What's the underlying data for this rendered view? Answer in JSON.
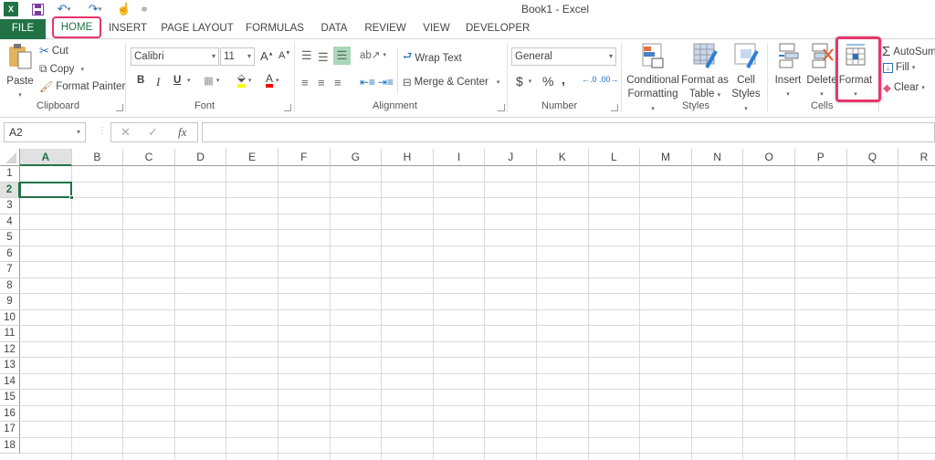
{
  "window": {
    "title": "Book1 - Excel"
  },
  "quick_access": [
    {
      "name": "excel-logo-icon"
    },
    {
      "name": "save-icon"
    },
    {
      "name": "undo-icon"
    },
    {
      "name": "redo-icon"
    },
    {
      "name": "touch-mode-icon"
    },
    {
      "name": "customize-qat-icon"
    }
  ],
  "tabs": [
    {
      "label": "FILE"
    },
    {
      "label": "HOME"
    },
    {
      "label": "INSERT"
    },
    {
      "label": "PAGE LAYOUT"
    },
    {
      "label": "FORMULAS"
    },
    {
      "label": "DATA"
    },
    {
      "label": "REVIEW"
    },
    {
      "label": "VIEW"
    },
    {
      "label": "DEVELOPER"
    }
  ],
  "ribbon": {
    "clipboard": {
      "label": "Clipboard",
      "paste": "Paste",
      "cut": "Cut",
      "copy": "Copy",
      "format_painter": "Format Painter"
    },
    "font": {
      "label": "Font",
      "font_name": "Calibri",
      "font_size": "11",
      "bold": "B",
      "italic": "I",
      "underline": "U",
      "highlight_color": "#ffff00",
      "font_color": "#ff0000"
    },
    "alignment": {
      "label": "Alignment",
      "wrap_text": "Wrap Text",
      "merge_center": "Merge & Center"
    },
    "number": {
      "label": "Number",
      "format": "General",
      "currency": "$",
      "percent": "%",
      "comma": ","
    },
    "styles": {
      "label": "Styles",
      "conditional_1": "Conditional",
      "conditional_2": "Formatting",
      "format_table_1": "Format as",
      "format_table_2": "Table",
      "cell_styles_1": "Cell",
      "cell_styles_2": "Styles"
    },
    "cells": {
      "label": "Cells",
      "insert": "Insert",
      "delete": "Delete",
      "format": "Format"
    },
    "editing": {
      "autosum": "AutoSum",
      "fill": "Fill",
      "clear": "Clear"
    }
  },
  "formula_bar": {
    "name_box": "A2",
    "cancel": "✕",
    "enter": "✓",
    "fx": "fx",
    "formula": ""
  },
  "grid": {
    "columns": [
      "A",
      "B",
      "C",
      "D",
      "E",
      "F",
      "G",
      "H",
      "I",
      "J",
      "K",
      "L",
      "M",
      "N",
      "O",
      "P",
      "Q",
      "R"
    ],
    "rows": [
      "1",
      "2",
      "3",
      "4",
      "5",
      "6",
      "7",
      "8",
      "9",
      "10",
      "11",
      "12",
      "13",
      "14",
      "15",
      "16",
      "17",
      "18"
    ],
    "selected_cell": "A2",
    "accent": "#217346"
  },
  "annotations": {
    "highlight_color": "#e8356b"
  }
}
